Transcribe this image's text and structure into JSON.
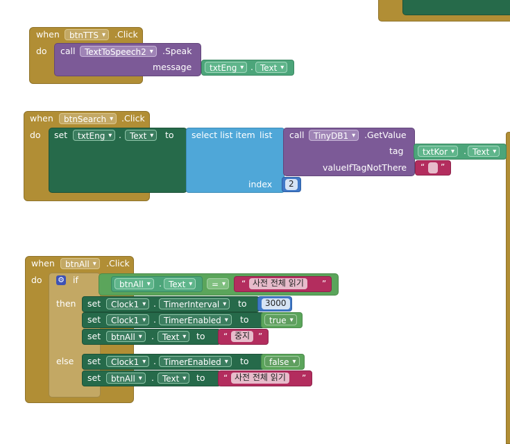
{
  "block_tts": {
    "when": "when",
    "do": "do",
    "component": "btnTTS",
    "event": ".Click",
    "call": "call",
    "target": "TextToSpeech2",
    "method": ".Speak",
    "param": "message",
    "arg_component": "txtEng",
    "arg_prop": "Text",
    "dot": "."
  },
  "block_search": {
    "when": "when",
    "do": "do",
    "component": "btnSearch",
    "event": ".Click",
    "set": "set",
    "set_component": "txtEng",
    "set_prop": "Text",
    "to": "to",
    "dot": ".",
    "select": "select list item",
    "list": "list",
    "index": "index",
    "index_value": "2",
    "call": "call",
    "db": "TinyDB1",
    "method": ".GetValue",
    "tag": "tag",
    "tag_component": "txtKor",
    "tag_prop": "Text",
    "value_label": "valueIfTagNotThere",
    "value_string": ""
  },
  "block_all": {
    "when": "when",
    "do": "do",
    "component": "btnAll",
    "event": ".Click",
    "if": "if",
    "then": "then",
    "else": "else",
    "dot": ".",
    "to": "to",
    "set": "set",
    "cond_component": "btnAll",
    "cond_prop": "Text",
    "op": "=",
    "cond_string": "사전 전체 읽기",
    "then_rows": [
      {
        "comp": "Clock1",
        "prop": "TimerInterval",
        "value": "3000"
      },
      {
        "comp": "Clock1",
        "prop": "TimerEnabled",
        "value": "true"
      },
      {
        "comp": "btnAll",
        "prop": "Text",
        "value": "중지"
      }
    ],
    "else_rows": [
      {
        "comp": "Clock1",
        "prop": "TimerEnabled",
        "value": "false"
      },
      {
        "comp": "btnAll",
        "prop": "Text",
        "value": "사전 전체 읽기"
      }
    ]
  },
  "colors": {
    "event": "#b18e35",
    "setter": "#266a4a",
    "procedure": "#7c5a97",
    "list": "#4fa7d8",
    "logic": "#5ba55b",
    "text": "#b32d5e",
    "math": "#3f78c7"
  },
  "quote_open": "“",
  "quote_close": "”"
}
